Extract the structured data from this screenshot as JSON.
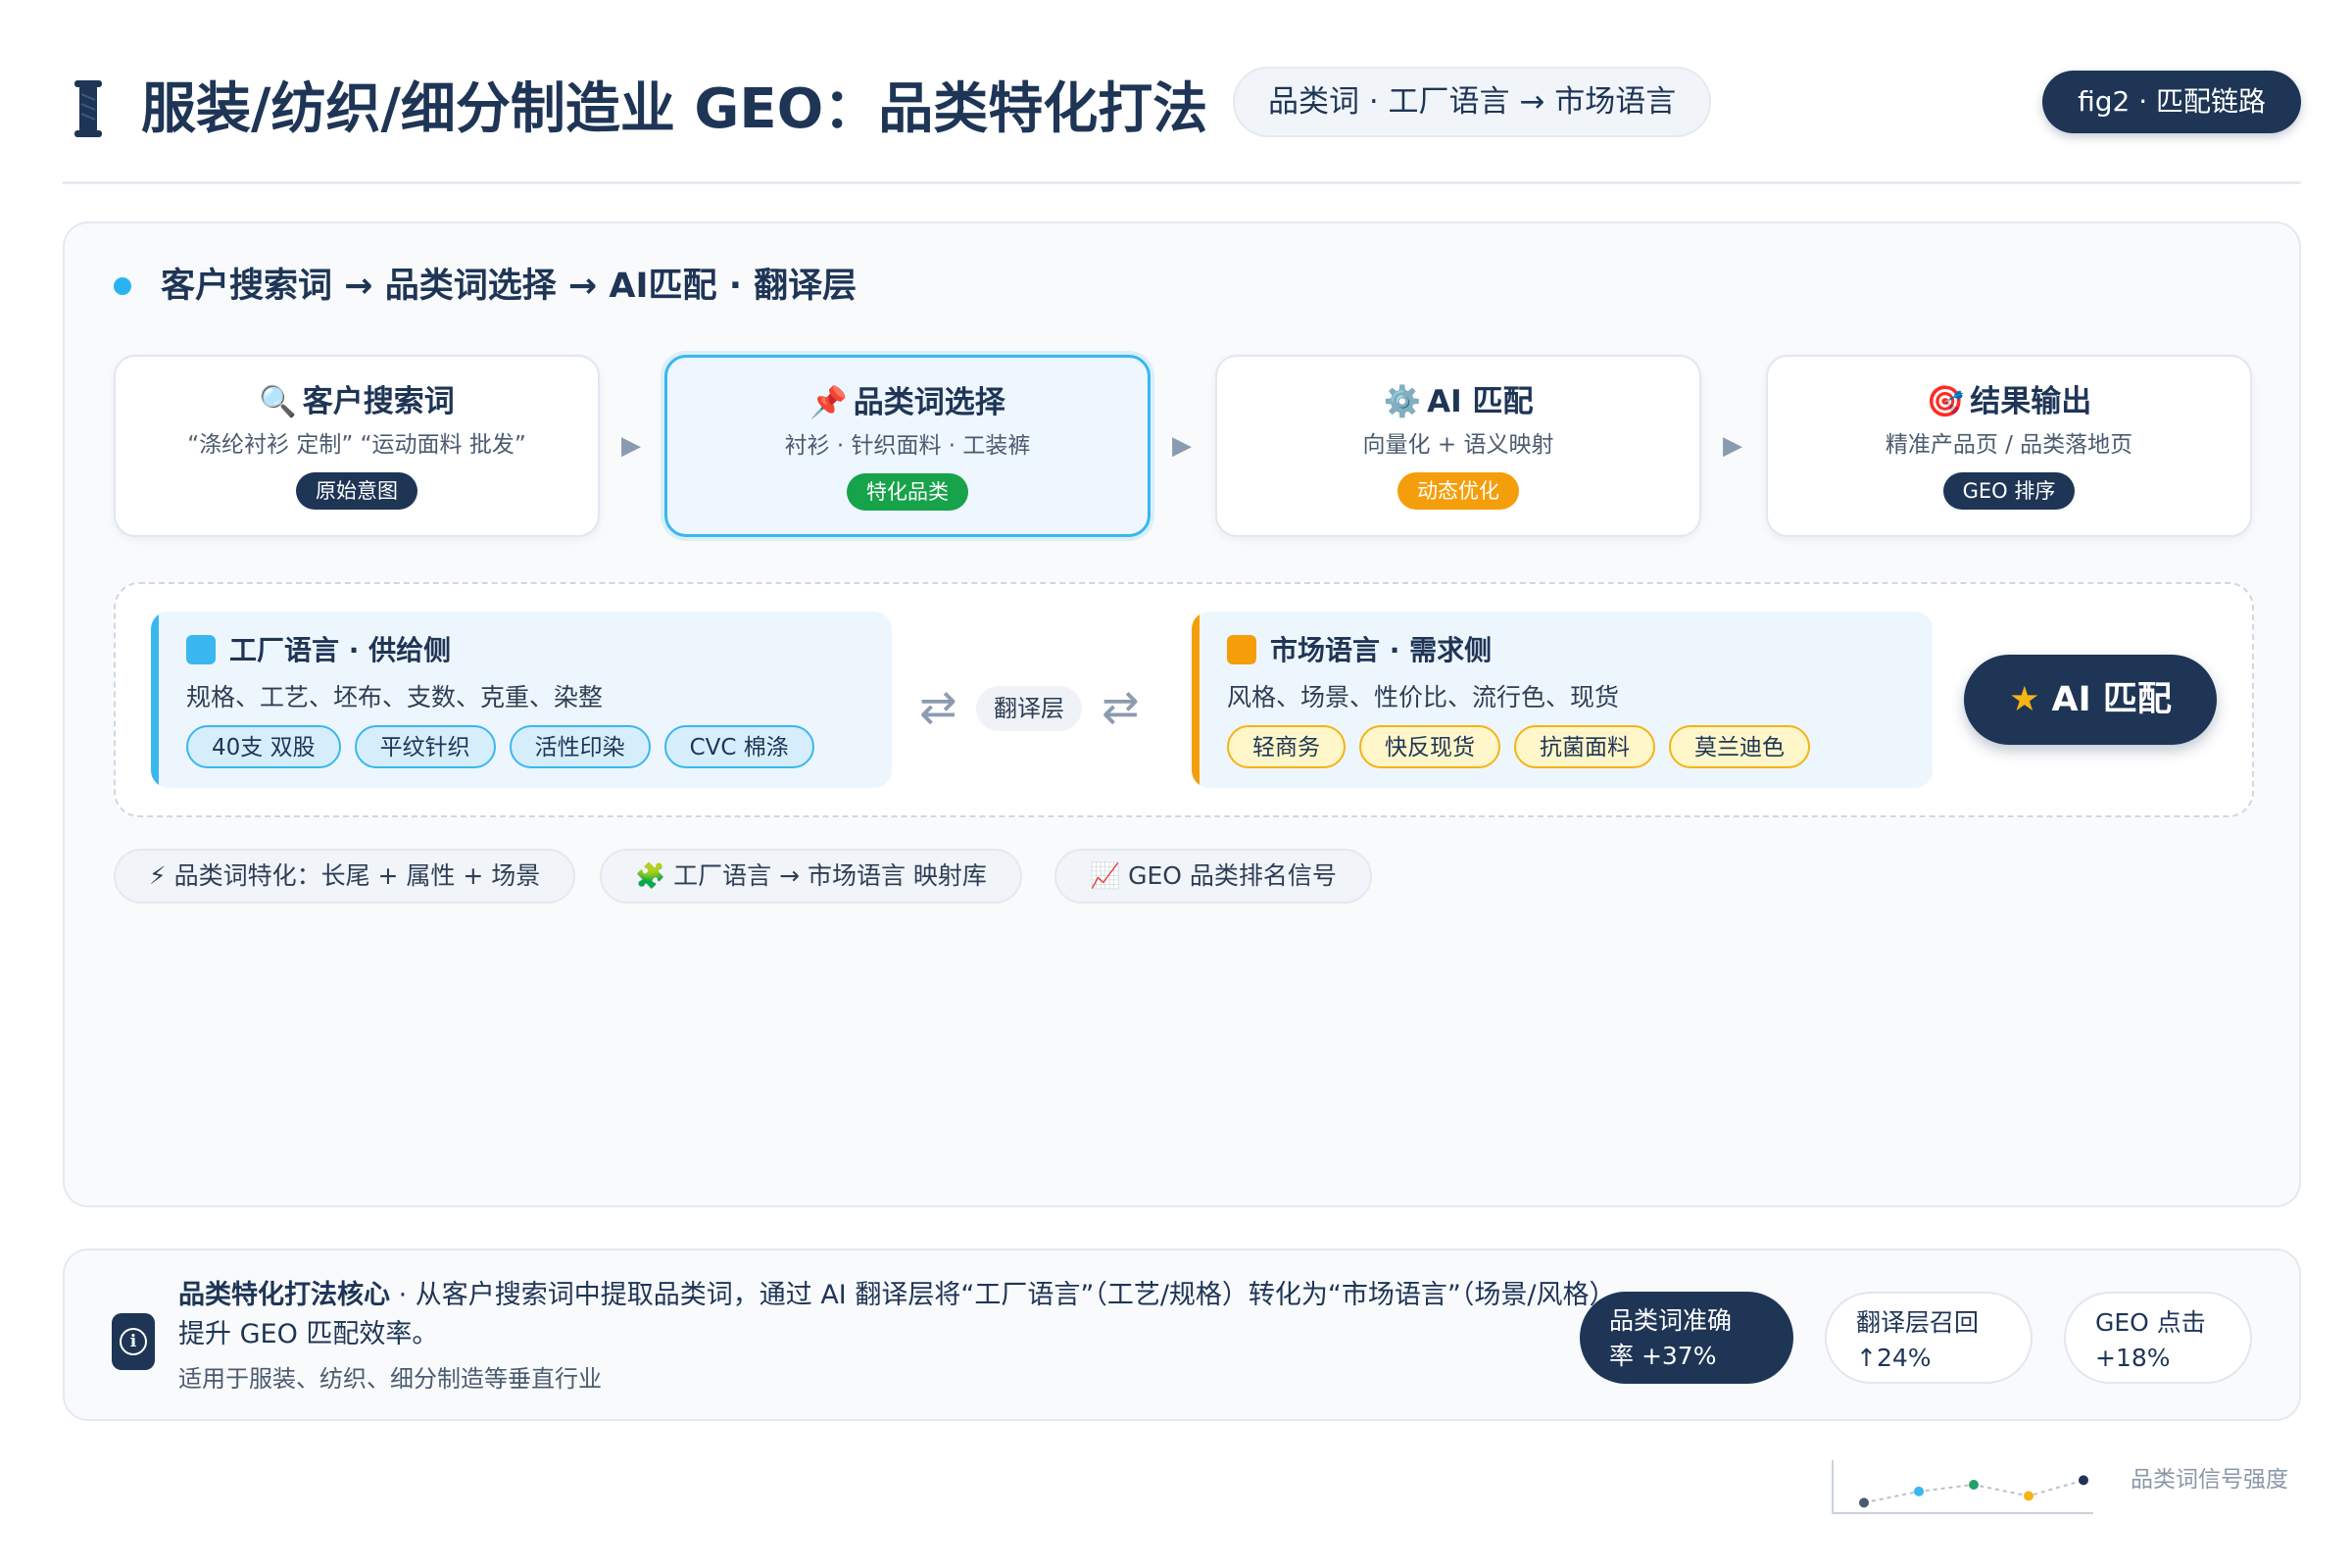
{
  "header": {
    "title": "服装/纺织/细分制造业 GEO：品类特化打法",
    "subtitle": "品类词 · 工厂语言 → 市场语言",
    "fig_label": "fig2 · 匹配链路"
  },
  "section": {
    "title": "客户搜索词 → 品类词选择 → AI匹配 · 翻译层"
  },
  "flow": [
    {
      "icon": "🔍",
      "icon_name": "magnifier-icon",
      "title": "客户搜索词",
      "desc": "“涤纶衬衫 定制”   “运动面料 批发”",
      "badge": "原始意图",
      "badge_color": "#1e3556"
    },
    {
      "icon": "📌",
      "icon_name": "pushpin-icon",
      "title": "品类词选择",
      "desc": "衬衫 · 针织面料 · 工装裤",
      "badge": "特化品类",
      "badge_color": "#16a34a"
    },
    {
      "icon": "⚙️",
      "icon_name": "gear-icon",
      "title": "AI 匹配",
      "desc": "向量化 + 语义映射",
      "badge": "动态优化",
      "badge_color": "#f59e0b"
    },
    {
      "icon": "🎯",
      "icon_name": "target-icon",
      "title": "结果输出",
      "desc": "精准产品页 / 品类落地页",
      "badge": "GEO 排序",
      "badge_color": "#1e3556"
    }
  ],
  "factory": {
    "title": "工厂语言 · 供给侧",
    "desc": "规格、工艺、坯布、支数、克重、染整",
    "tags": [
      "40支 双股",
      "平纹针织",
      "活性印染",
      "CVC 棉涤"
    ],
    "accent": "#39b7ef"
  },
  "translation_label": "翻译层",
  "market": {
    "title": "市场语言 · 需求侧",
    "desc": "风格、场景、性价比、流行色、现货",
    "tags": [
      "轻商务",
      "快反现货",
      "抗菌面料",
      "莫兰迪色"
    ],
    "accent": "#f59e0b"
  },
  "ai_match_button": "AI 匹配",
  "chips": [
    {
      "icon": "⚡",
      "icon_name": "lightning-icon",
      "label": "品类词特化：长尾 + 属性 + 场景"
    },
    {
      "icon": "🧩",
      "icon_name": "puzzle-icon",
      "label": "工厂语言 → 市场语言 映射库"
    },
    {
      "icon": "📈",
      "icon_name": "chart-up-icon",
      "label": "GEO 品类排名信号"
    }
  ],
  "info": {
    "lead": "品类特化打法核心",
    "body": " · 从客户搜索词中提取品类词，通过 AI 翻译层将“工厂语言”（工艺/规格）转化为“市场语言”（场景/风格），提升 GEO 匹配效率。",
    "note": "适用于服装、纺织、细分制造等垂直行业"
  },
  "stats": [
    {
      "line1": "品类词准确",
      "line2": "率 +37%"
    },
    {
      "line1": "翻译层召回",
      "line2": "↑24%"
    },
    {
      "line1": "GEO 点击",
      "line2": "+18%"
    }
  ],
  "signal": {
    "label": "品类词信号强度",
    "values": [
      0.1,
      0.35,
      0.5,
      0.25,
      0.6
    ],
    "colors": [
      "#4b5b70",
      "#39b7ef",
      "#22a06b",
      "#f5b316",
      "#1e3556"
    ]
  }
}
